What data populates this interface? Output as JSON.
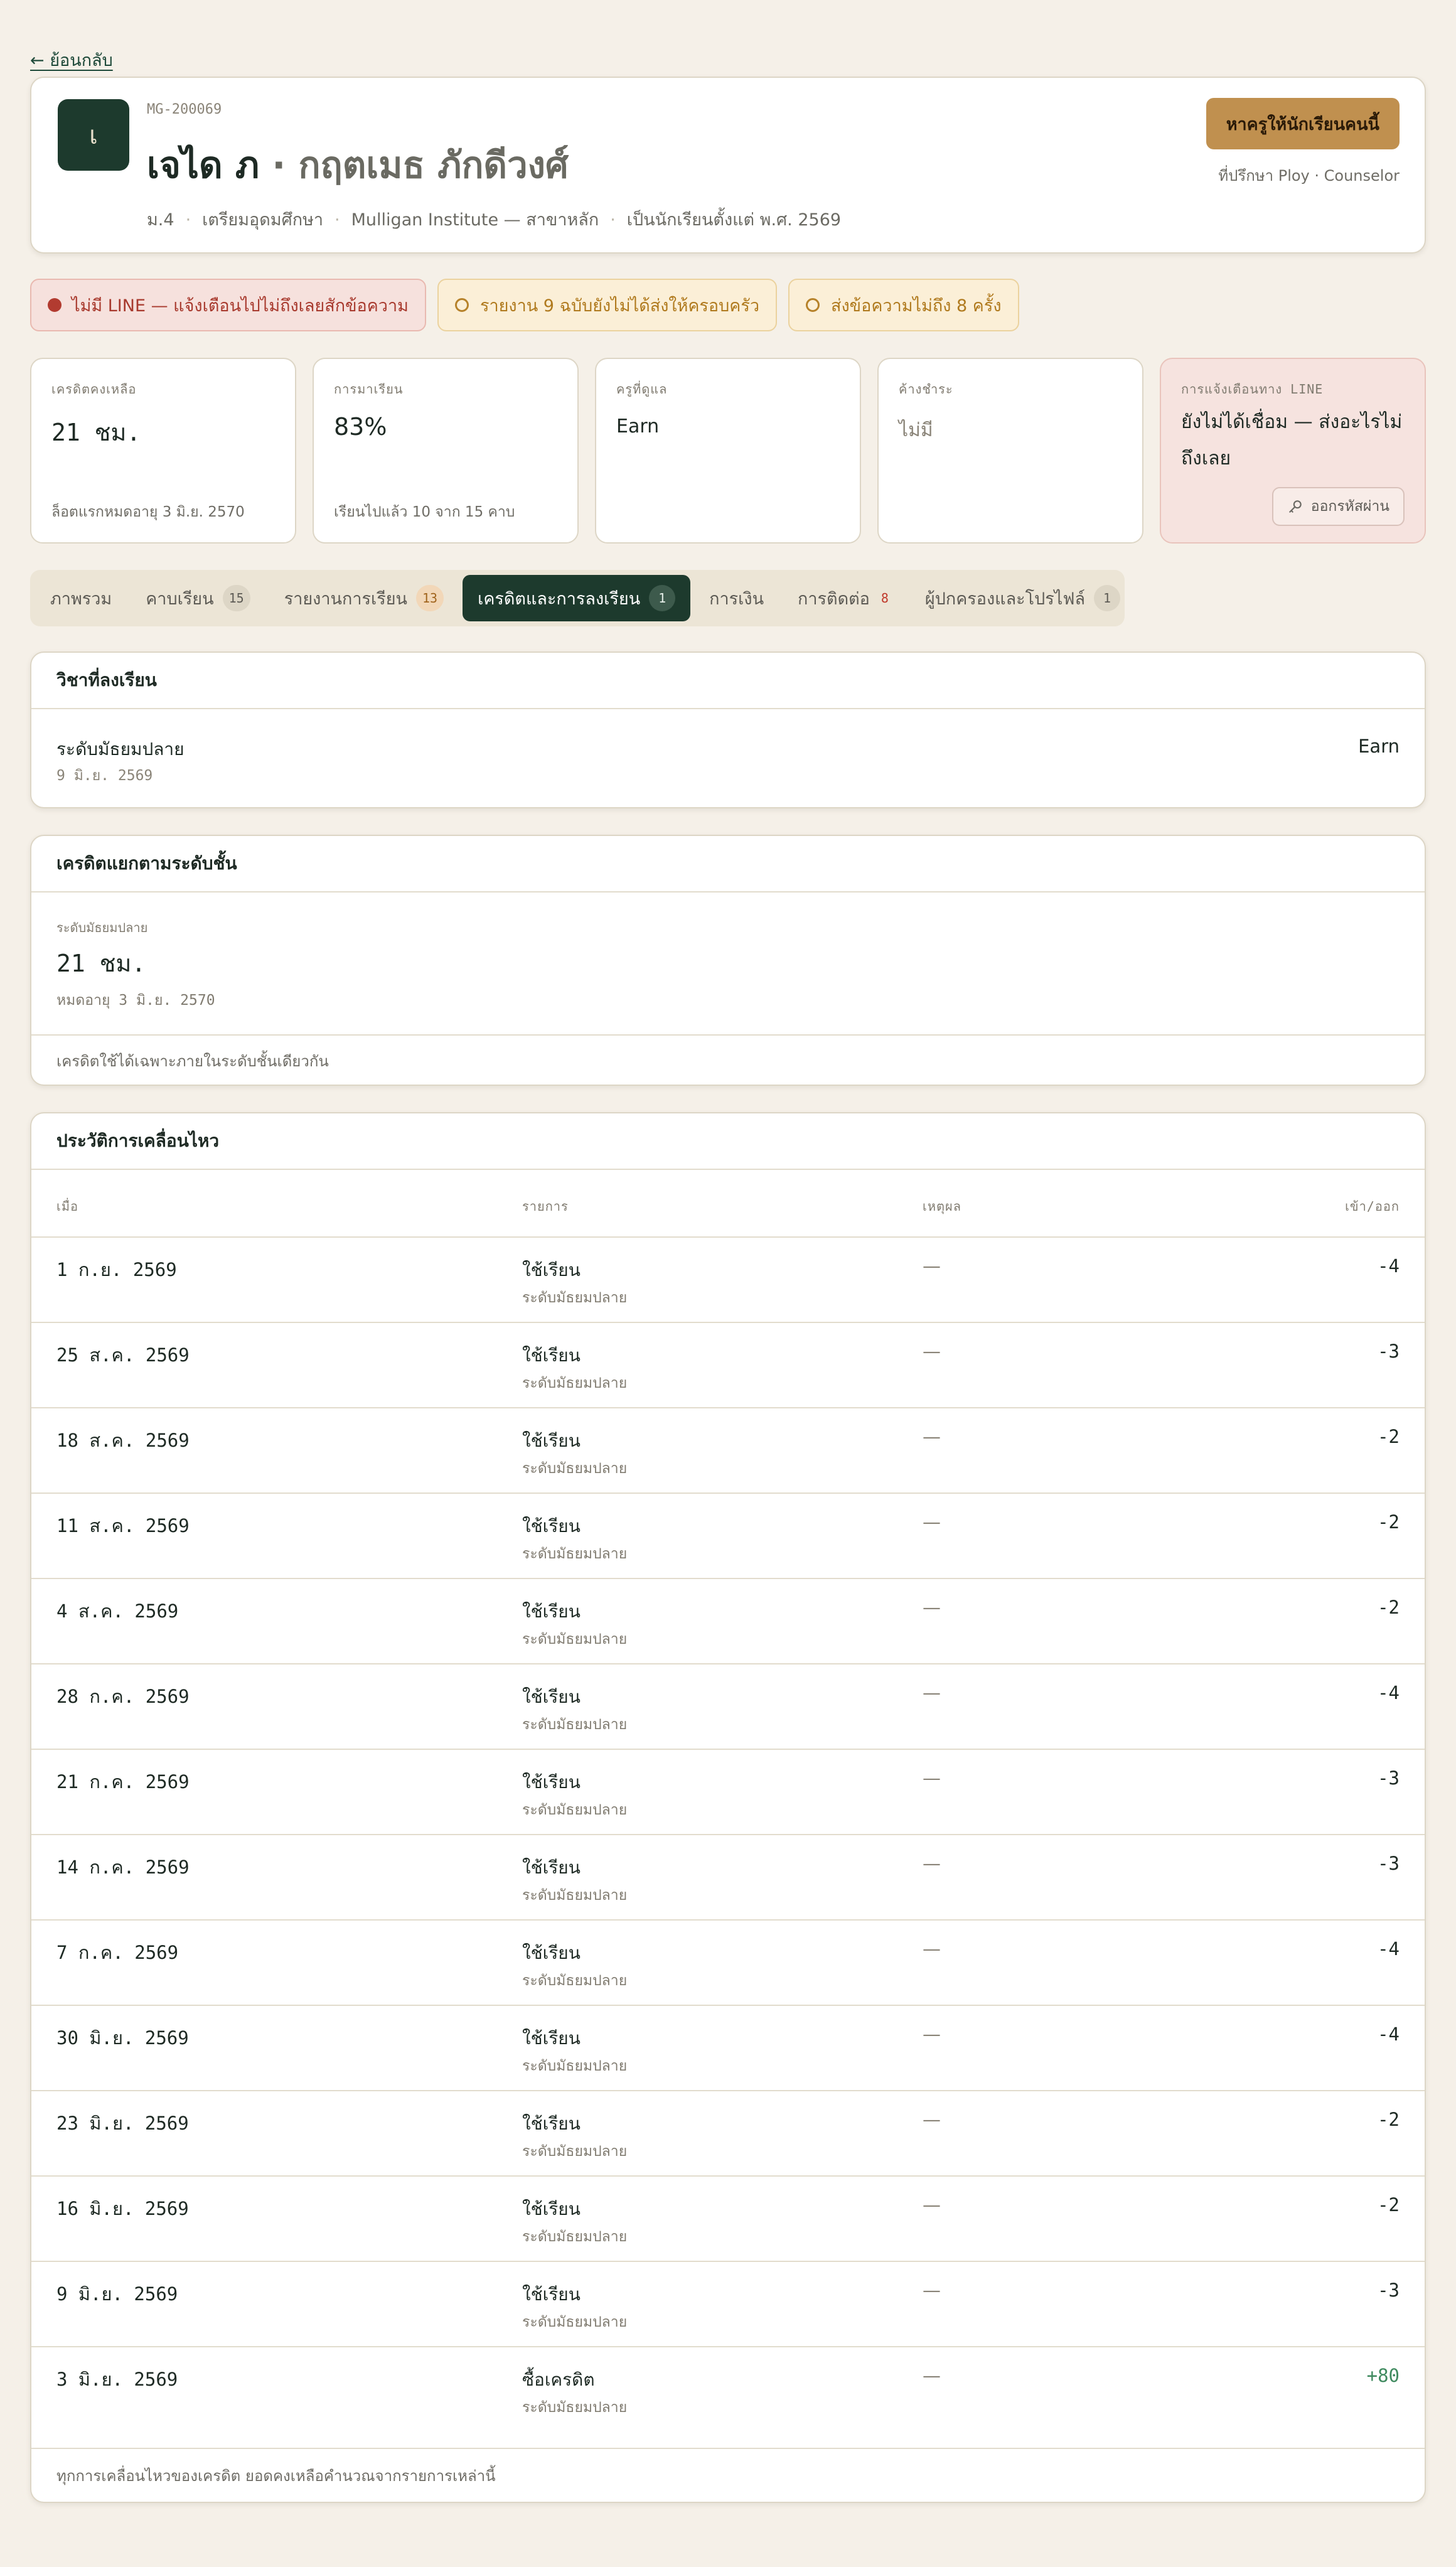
{
  "nav": {
    "back_label": "← ย้อนกลับ"
  },
  "student": {
    "avatar_letter": "เ",
    "id": "MG-200069",
    "first_name": "เจได ภ",
    "separator": "·",
    "last_name": "กฤตเมธ ภักดีวงศ์",
    "grade": "ม.4",
    "program": "เตรียมอุดมศึกษา",
    "institute": "Mulligan Institute — สาขาหลัก",
    "since": "เป็นนักเรียนตั้งแต่ พ.ศ. 2569",
    "meta_dot": "·",
    "find_tutor_label": "หาครูให้นักเรียนคนนี้",
    "counselor": "ที่ปรึกษา Ploy · Counselor"
  },
  "alerts": [
    {
      "text": "ไม่มี LINE — แจ้งเตือนไปไม่ถึงเลยสักข้อความ",
      "tone": "red"
    },
    {
      "text": "รายงาน 9 ฉบับยังไม่ได้ส่งให้ครอบครัว",
      "tone": "amber"
    },
    {
      "text": "ส่งข้อความไม่ถึง 8 ครั้ง",
      "tone": "amber"
    }
  ],
  "stats": {
    "credit": {
      "label": "เครดิตคงเหลือ",
      "value": "21 ชม.",
      "foot": "ล็อตแรกหมดอายุ 3 มิ.ย. 2570"
    },
    "attendance": {
      "label": "การมาเรียน",
      "value": "83%",
      "foot": "เรียนไปแล้ว 10 จาก 15 คาบ"
    },
    "teacher": {
      "label": "ครูที่ดูแล",
      "value": "Earn"
    },
    "outstanding": {
      "label": "ค้างชำระ",
      "value": "ไม่มี"
    },
    "line": {
      "label": "การแจ้งเตือนทาง LINE",
      "value": "ยังไม่ได้เชื่อม — ส่งอะไรไม่ถึงเลย",
      "button": "ออกรหัสผ่าน"
    }
  },
  "tabs": [
    {
      "label": "ภาพรวม",
      "badge": ""
    },
    {
      "label": "คาบเรียน",
      "badge": "15"
    },
    {
      "label": "รายงานการเรียน",
      "badge": "13"
    },
    {
      "label": "เครดิตและการลงเรียน",
      "badge": "1"
    },
    {
      "label": "การเงิน",
      "badge": ""
    },
    {
      "label": "การติดต่อ",
      "badge": "8"
    },
    {
      "label": "ผู้ปกครองและโปรไฟล์",
      "badge": "1"
    }
  ],
  "enrollment": {
    "title": "วิชาที่ลงเรียน",
    "course": "ระดับมัธยมปลาย",
    "date": "9 มิ.ย. 2569",
    "teacher": "Earn"
  },
  "credit_levels": {
    "title": "เครดิตแยกตามระดับชั้น",
    "level_label": "ระดับมัธยมปลาย",
    "value": "21 ชม.",
    "expire": "หมดอายุ 3 มิ.ย. 2570",
    "note": "เครดิตใช้ได้เฉพาะภายในระดับชั้นเดียวกัน"
  },
  "history": {
    "title": "ประวัติการเคลื่อนไหว",
    "col_when": "เมื่อ",
    "col_item": "รายการ",
    "col_reason": "เหตุผล",
    "col_amount": "เข้า/ออก",
    "rows": [
      {
        "date": "1 ก.ย. 2569",
        "item": "ใช้เรียน",
        "sub": "ระดับมัธยมปลาย",
        "reason": "—",
        "amount": "-4"
      },
      {
        "date": "25 ส.ค. 2569",
        "item": "ใช้เรียน",
        "sub": "ระดับมัธยมปลาย",
        "reason": "—",
        "amount": "-3"
      },
      {
        "date": "18 ส.ค. 2569",
        "item": "ใช้เรียน",
        "sub": "ระดับมัธยมปลาย",
        "reason": "—",
        "amount": "-2"
      },
      {
        "date": "11 ส.ค. 2569",
        "item": "ใช้เรียน",
        "sub": "ระดับมัธยมปลาย",
        "reason": "—",
        "amount": "-2"
      },
      {
        "date": "4 ส.ค. 2569",
        "item": "ใช้เรียน",
        "sub": "ระดับมัธยมปลาย",
        "reason": "—",
        "amount": "-2"
      },
      {
        "date": "28 ก.ค. 2569",
        "item": "ใช้เรียน",
        "sub": "ระดับมัธยมปลาย",
        "reason": "—",
        "amount": "-4"
      },
      {
        "date": "21 ก.ค. 2569",
        "item": "ใช้เรียน",
        "sub": "ระดับมัธยมปลาย",
        "reason": "—",
        "amount": "-3"
      },
      {
        "date": "14 ก.ค. 2569",
        "item": "ใช้เรียน",
        "sub": "ระดับมัธยมปลาย",
        "reason": "—",
        "amount": "-3"
      },
      {
        "date": "7 ก.ค. 2569",
        "item": "ใช้เรียน",
        "sub": "ระดับมัธยมปลาย",
        "reason": "—",
        "amount": "-4"
      },
      {
        "date": "30 มิ.ย. 2569",
        "item": "ใช้เรียน",
        "sub": "ระดับมัธยมปลาย",
        "reason": "—",
        "amount": "-4"
      },
      {
        "date": "23 มิ.ย. 2569",
        "item": "ใช้เรียน",
        "sub": "ระดับมัธยมปลาย",
        "reason": "—",
        "amount": "-2"
      },
      {
        "date": "16 มิ.ย. 2569",
        "item": "ใช้เรียน",
        "sub": "ระดับมัธยมปลาย",
        "reason": "—",
        "amount": "-2"
      },
      {
        "date": "9 มิ.ย. 2569",
        "item": "ใช้เรียน",
        "sub": "ระดับมัธยมปลาย",
        "reason": "—",
        "amount": "-3"
      },
      {
        "date": "3 มิ.ย. 2569",
        "item": "ซื้อเครดิต",
        "sub": "ระดับมัธยมปลาย",
        "reason": "—",
        "amount": "+80"
      }
    ],
    "footer": "ทุกการเคลื่อนไหวของเครดิต ยอดคงเหลือคำนวณจากรายการเหล่านี้"
  }
}
